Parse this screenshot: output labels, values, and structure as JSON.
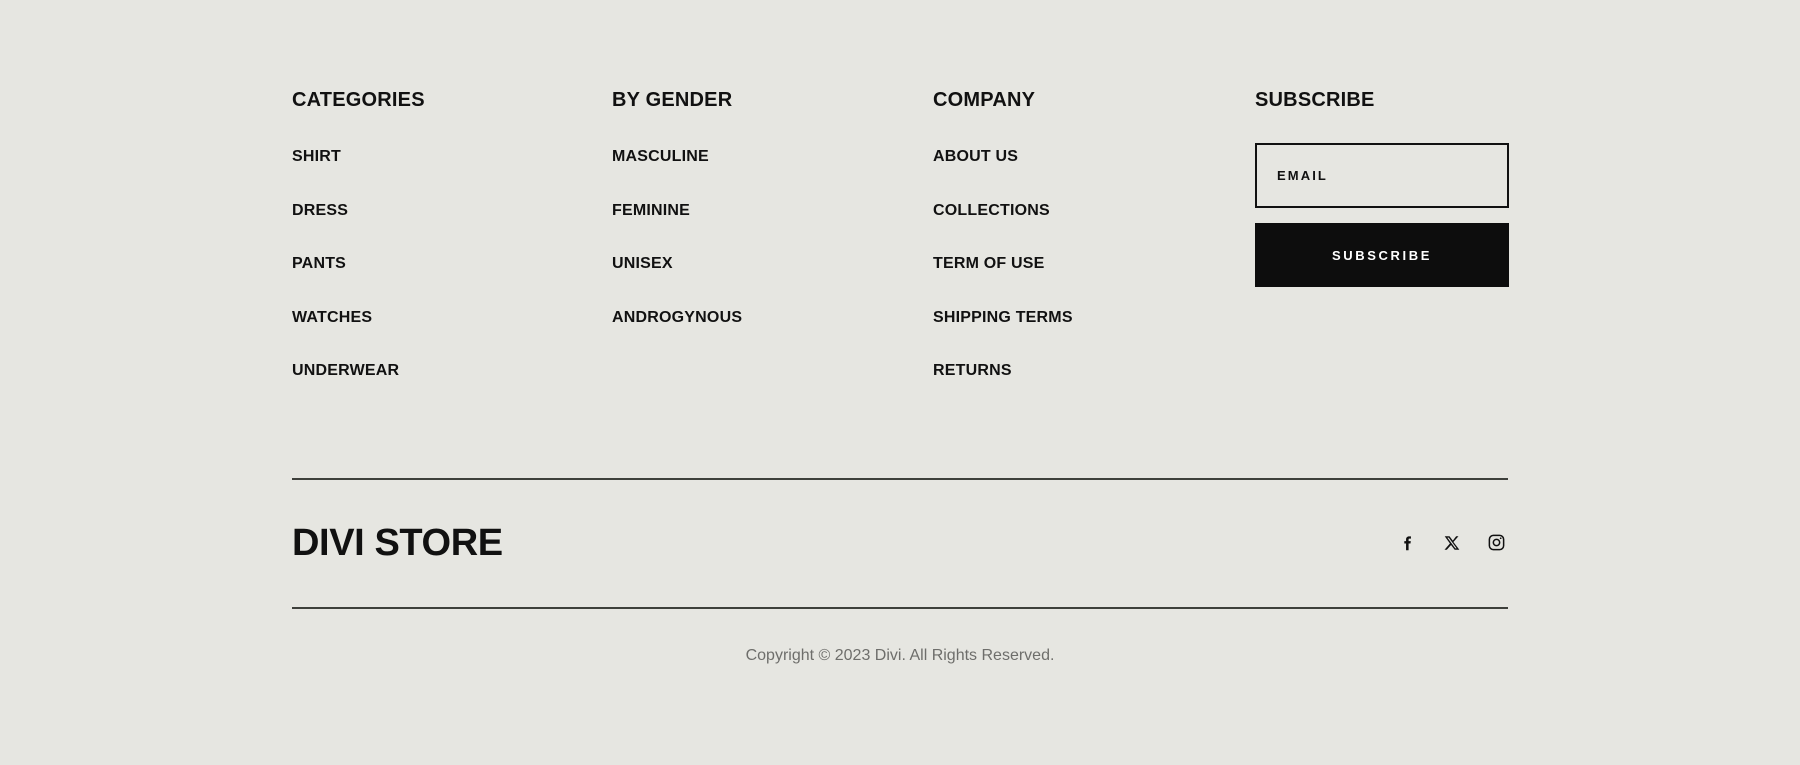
{
  "background_color": "#e6e6e1",
  "accent_color": "#111111",
  "columns": [
    {
      "title": "CATEGORIES",
      "links": [
        "SHIRT",
        "DRESS",
        "PANTS",
        "WATCHES",
        "UNDERWEAR"
      ]
    },
    {
      "title": "BY GENDER",
      "links": [
        "MASCULINE",
        "FEMININE",
        "UNISEX",
        "ANDROGYNOUS"
      ]
    },
    {
      "title": "COMPANY",
      "links": [
        "ABOUT US",
        "COLLECTIONS",
        "TERM OF USE",
        "SHIPPING TERMS",
        "RETURNS"
      ]
    }
  ],
  "subscribe": {
    "title": "SUBSCRIBE",
    "email_placeholder": "EMAIL",
    "email_value": "",
    "button_label": "SUBSCRIBE"
  },
  "brand": {
    "name": "DIVI STORE"
  },
  "socials": [
    {
      "name": "facebook",
      "icon": "facebook-icon"
    },
    {
      "name": "x-twitter",
      "icon": "x-twitter-icon"
    },
    {
      "name": "instagram",
      "icon": "instagram-icon"
    }
  ],
  "copyright": "Copyright © 2023 Divi. All Rights Reserved."
}
